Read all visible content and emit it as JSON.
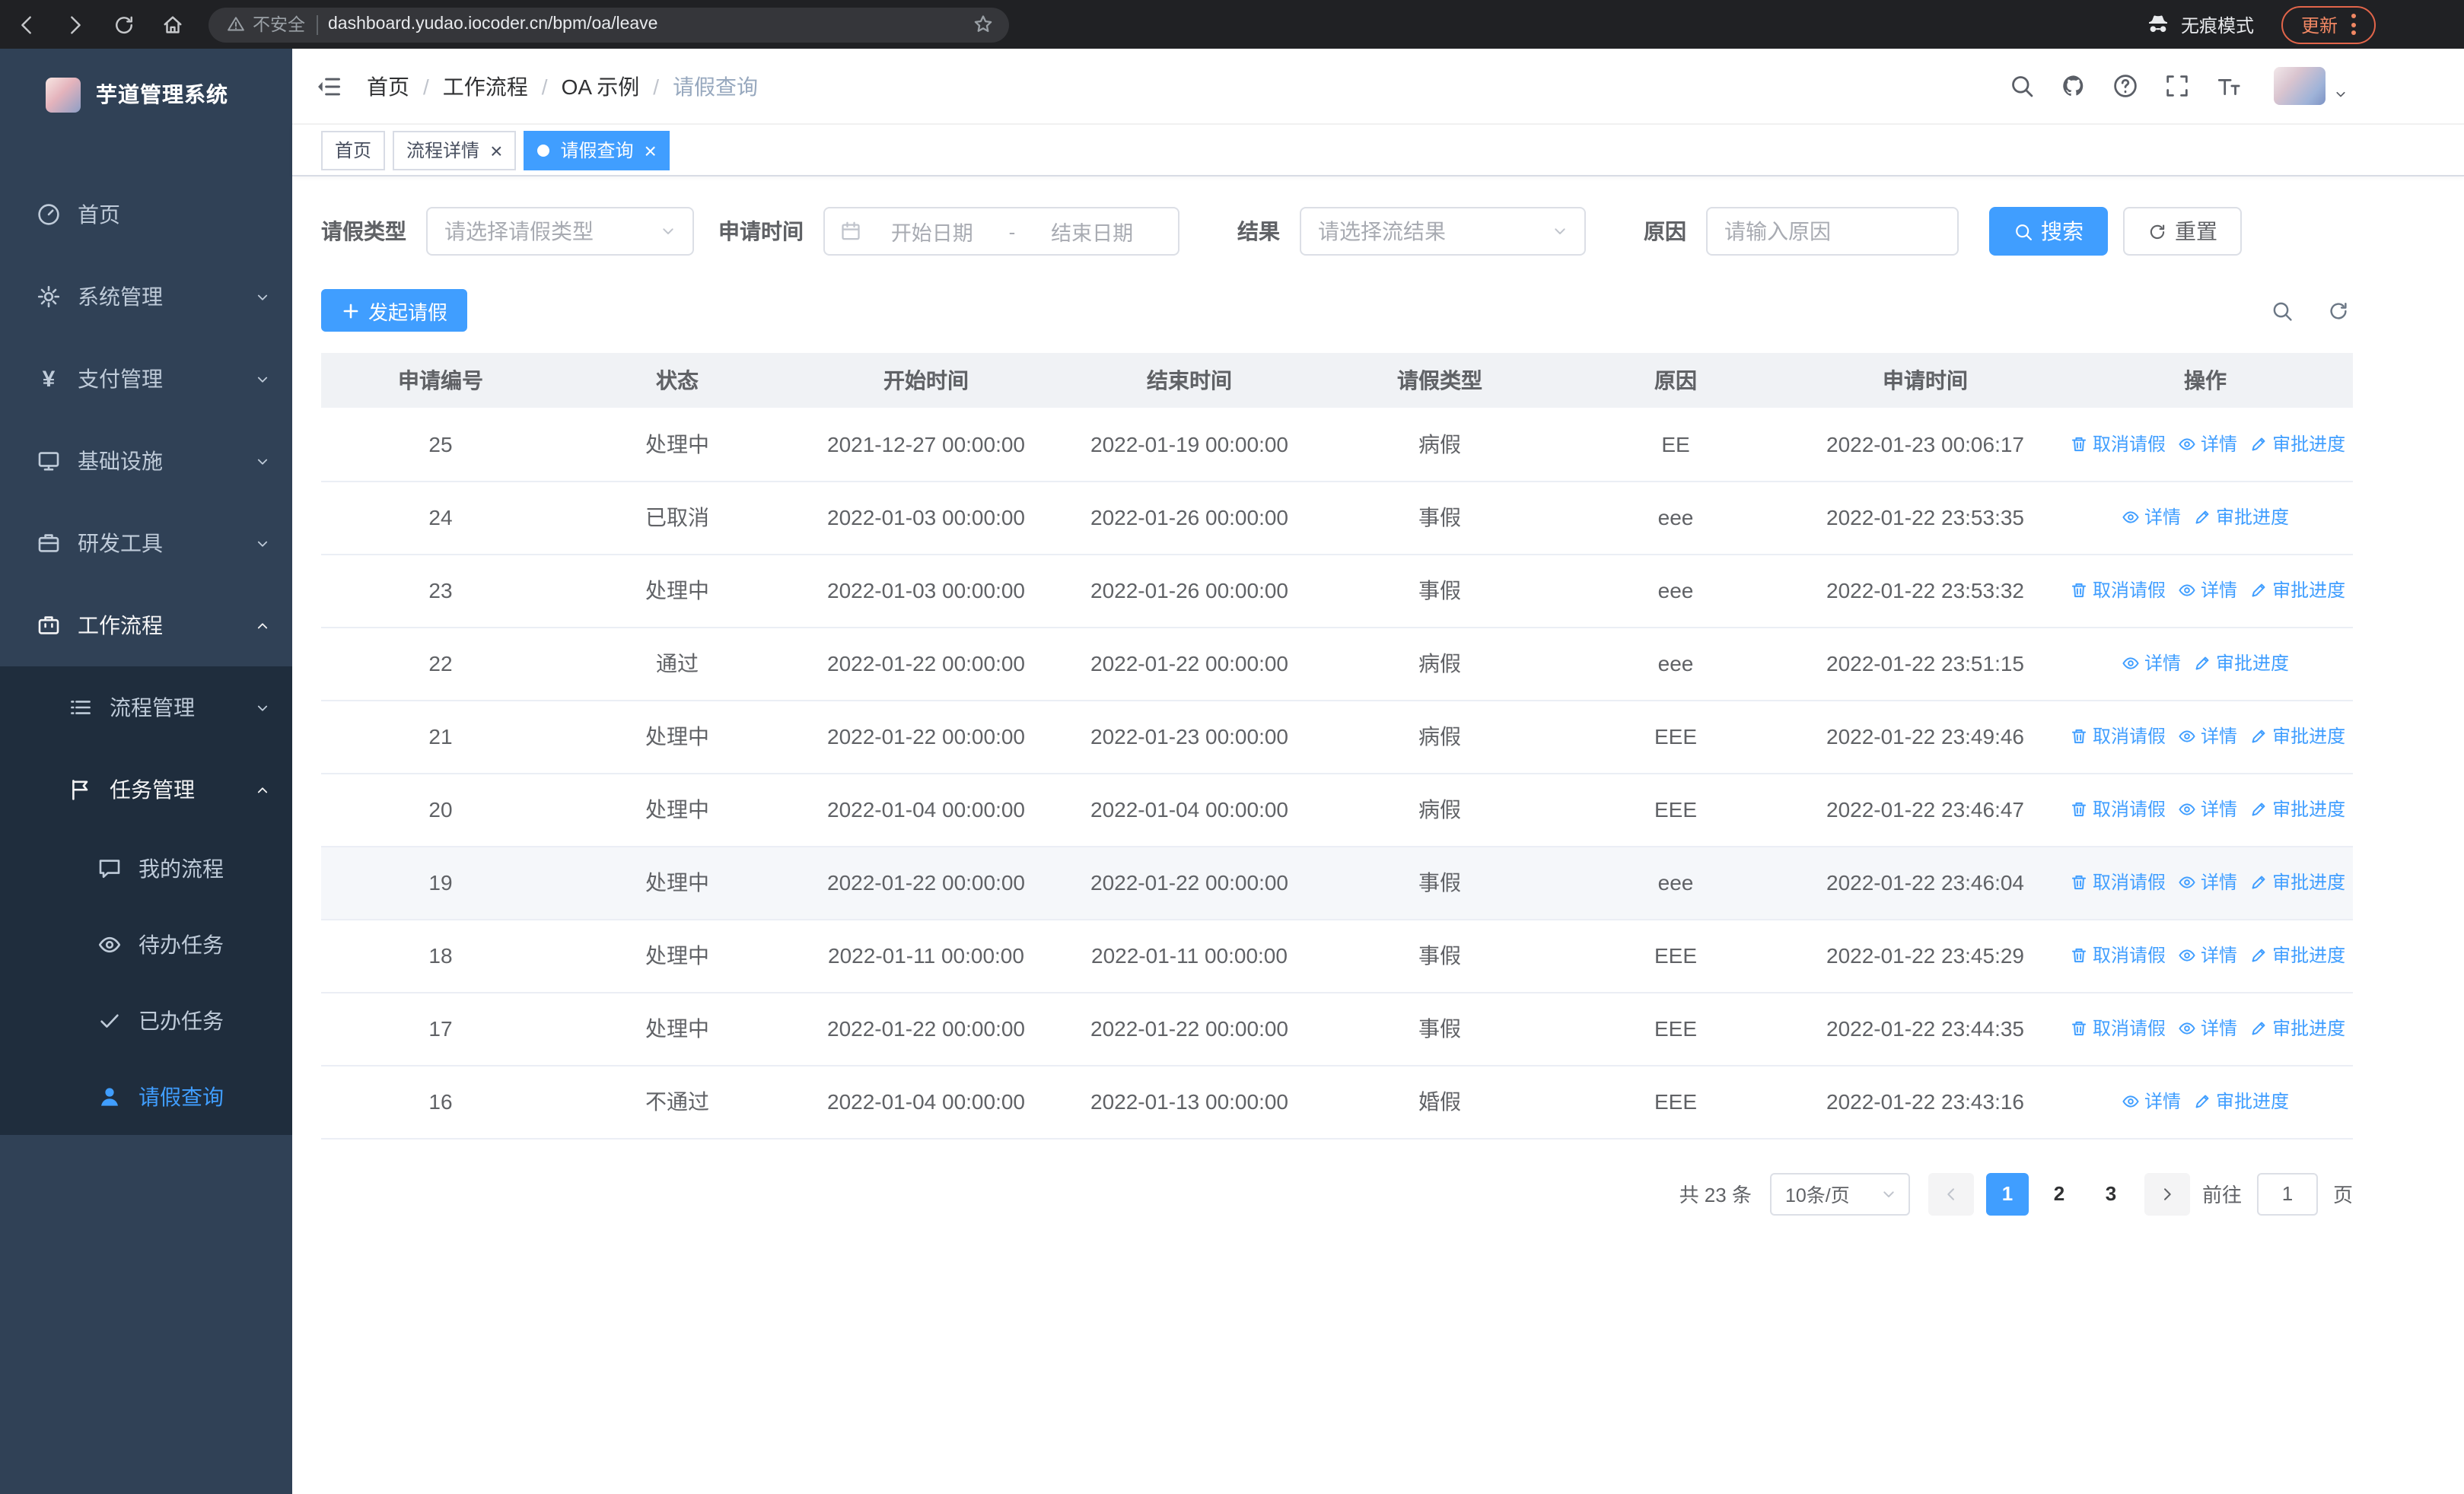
{
  "browser": {
    "security_chip": "不安全",
    "url": "dashboard.yudao.iocoder.cn/bpm/oa/leave",
    "incognito_label": "无痕模式",
    "update_button": "更新"
  },
  "sidebar": {
    "logo_title": "芋道管理系统",
    "menu": [
      {
        "name": "home",
        "label": "首页",
        "icon": "dashboard",
        "level": 1
      },
      {
        "name": "system-mgmt",
        "label": "系统管理",
        "icon": "gear",
        "level": 1,
        "chevron": "down"
      },
      {
        "name": "payment-mgmt",
        "label": "支付管理",
        "icon": "yen",
        "level": 1,
        "chevron": "down"
      },
      {
        "name": "infrastructure",
        "label": "基础设施",
        "icon": "monitor",
        "level": 1,
        "chevron": "down"
      },
      {
        "name": "dev-tools",
        "label": "研发工具",
        "icon": "briefcase",
        "level": 1,
        "chevron": "down"
      },
      {
        "name": "workflow",
        "label": "工作流程",
        "icon": "suitcase",
        "level": 1,
        "chevron": "up",
        "open": true
      },
      {
        "name": "process-mgmt",
        "label": "流程管理",
        "icon": "list",
        "level": 2,
        "chevron": "down"
      },
      {
        "name": "task-mgmt",
        "label": "任务管理",
        "icon": "flag",
        "level": 2,
        "chevron": "up",
        "open": true
      },
      {
        "name": "my-process",
        "label": "我的流程",
        "icon": "chat",
        "level": 3
      },
      {
        "name": "todo-tasks",
        "label": "待办任务",
        "icon": "eye",
        "level": 3
      },
      {
        "name": "done-tasks",
        "label": "已办任务",
        "icon": "check",
        "level": 3
      },
      {
        "name": "leave-query",
        "label": "请假查询",
        "icon": "user",
        "level": 3,
        "active": true
      }
    ]
  },
  "navbar": {
    "breadcrumb": [
      "首页",
      "工作流程",
      "OA 示例",
      "请假查询"
    ]
  },
  "tabs": [
    {
      "name": "home",
      "label": "首页"
    },
    {
      "name": "process-detail",
      "label": "流程详情",
      "closable": true
    },
    {
      "name": "leave-query",
      "label": "请假查询",
      "closable": true,
      "active": true
    }
  ],
  "filters": {
    "leave_type_label": "请假类型",
    "leave_type_placeholder": "请选择请假类型",
    "apply_time_label": "申请时间",
    "start_date_placeholder": "开始日期",
    "date_separator": "-",
    "end_date_placeholder": "结束日期",
    "result_label": "结果",
    "result_placeholder": "请选择流结果",
    "reason_label": "原因",
    "reason_placeholder": "请输入原因",
    "search_button": "搜索",
    "reset_button": "重置"
  },
  "toolbar": {
    "create_button": "发起请假"
  },
  "table": {
    "columns": [
      "申请编号",
      "状态",
      "开始时间",
      "结束时间",
      "请假类型",
      "原因",
      "申请时间",
      "操作"
    ],
    "actions": {
      "cancel": "取消请假",
      "detail": "详情",
      "progress": "审批进度"
    },
    "rows": [
      {
        "id": "25",
        "status": "处理中",
        "start": "2021-12-27 00:00:00",
        "end": "2022-01-19 00:00:00",
        "type": "病假",
        "reason": "EE",
        "apply_time": "2022-01-23 00:06:17",
        "can_cancel": true
      },
      {
        "id": "24",
        "status": "已取消",
        "start": "2022-01-03 00:00:00",
        "end": "2022-01-26 00:00:00",
        "type": "事假",
        "reason": "eee",
        "apply_time": "2022-01-22 23:53:35",
        "can_cancel": false
      },
      {
        "id": "23",
        "status": "处理中",
        "start": "2022-01-03 00:00:00",
        "end": "2022-01-26 00:00:00",
        "type": "事假",
        "reason": "eee",
        "apply_time": "2022-01-22 23:53:32",
        "can_cancel": true
      },
      {
        "id": "22",
        "status": "通过",
        "start": "2022-01-22 00:00:00",
        "end": "2022-01-22 00:00:00",
        "type": "病假",
        "reason": "eee",
        "apply_time": "2022-01-22 23:51:15",
        "can_cancel": false
      },
      {
        "id": "21",
        "status": "处理中",
        "start": "2022-01-22 00:00:00",
        "end": "2022-01-23 00:00:00",
        "type": "病假",
        "reason": "EEE",
        "apply_time": "2022-01-22 23:49:46",
        "can_cancel": true
      },
      {
        "id": "20",
        "status": "处理中",
        "start": "2022-01-04 00:00:00",
        "end": "2022-01-04 00:00:00",
        "type": "病假",
        "reason": "EEE",
        "apply_time": "2022-01-22 23:46:47",
        "can_cancel": true
      },
      {
        "id": "19",
        "status": "处理中",
        "start": "2022-01-22 00:00:00",
        "end": "2022-01-22 00:00:00",
        "type": "事假",
        "reason": "eee",
        "apply_time": "2022-01-22 23:46:04",
        "can_cancel": true,
        "highlighted": true
      },
      {
        "id": "18",
        "status": "处理中",
        "start": "2022-01-11 00:00:00",
        "end": "2022-01-11 00:00:00",
        "type": "事假",
        "reason": "EEE",
        "apply_time": "2022-01-22 23:45:29",
        "can_cancel": true
      },
      {
        "id": "17",
        "status": "处理中",
        "start": "2022-01-22 00:00:00",
        "end": "2022-01-22 00:00:00",
        "type": "事假",
        "reason": "EEE",
        "apply_time": "2022-01-22 23:44:35",
        "can_cancel": true
      },
      {
        "id": "16",
        "status": "不通过",
        "start": "2022-01-04 00:00:00",
        "end": "2022-01-13 00:00:00",
        "type": "婚假",
        "reason": "EEE",
        "apply_time": "2022-01-22 23:43:16",
        "can_cancel": false
      }
    ]
  },
  "pagination": {
    "total_text": "共 23 条",
    "page_size": "10条/页",
    "pages": [
      {
        "label": "1",
        "active": true
      },
      {
        "label": "2"
      },
      {
        "label": "3"
      }
    ],
    "goto_label": "前往",
    "goto_value": "1",
    "page_label": "页"
  }
}
